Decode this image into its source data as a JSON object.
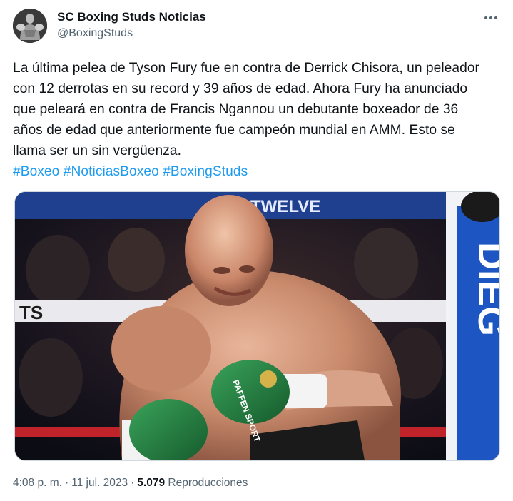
{
  "author": {
    "display_name": "SC Boxing Studs Noticias",
    "handle": "@BoxingStuds",
    "avatar_icon": "boxer-silhouette-avatar"
  },
  "tweet": {
    "text": "La última pelea de Tyson Fury fue en contra de Derrick Chisora, un peleador con 12 derrotas en su record y 39 años de edad. Ahora Fury ha anunciado que peleará en contra de Francis Ngannou un debutante boxeador de 36 años de edad que anteriormente fue campeón mundial en AMM. Esto se llama ser un sin vergüenza.",
    "hashtags": [
      "#Boxeo",
      "#NoticiasBoxeo",
      "#BoxingStuds"
    ]
  },
  "media": {
    "banner_text_top": "TWELVE",
    "banner_text_left": "TS",
    "corner_pad_text": "DIEG",
    "glove_text": "PAFFEN SPORT"
  },
  "meta": {
    "time": "4:08 p. m.",
    "date": "11 jul. 2023",
    "views_count": "5.079",
    "views_label": "Reproducciones"
  },
  "colors": {
    "link": "#1d9bf0",
    "secondary_text": "#536471",
    "primary_text": "#0f1419"
  }
}
